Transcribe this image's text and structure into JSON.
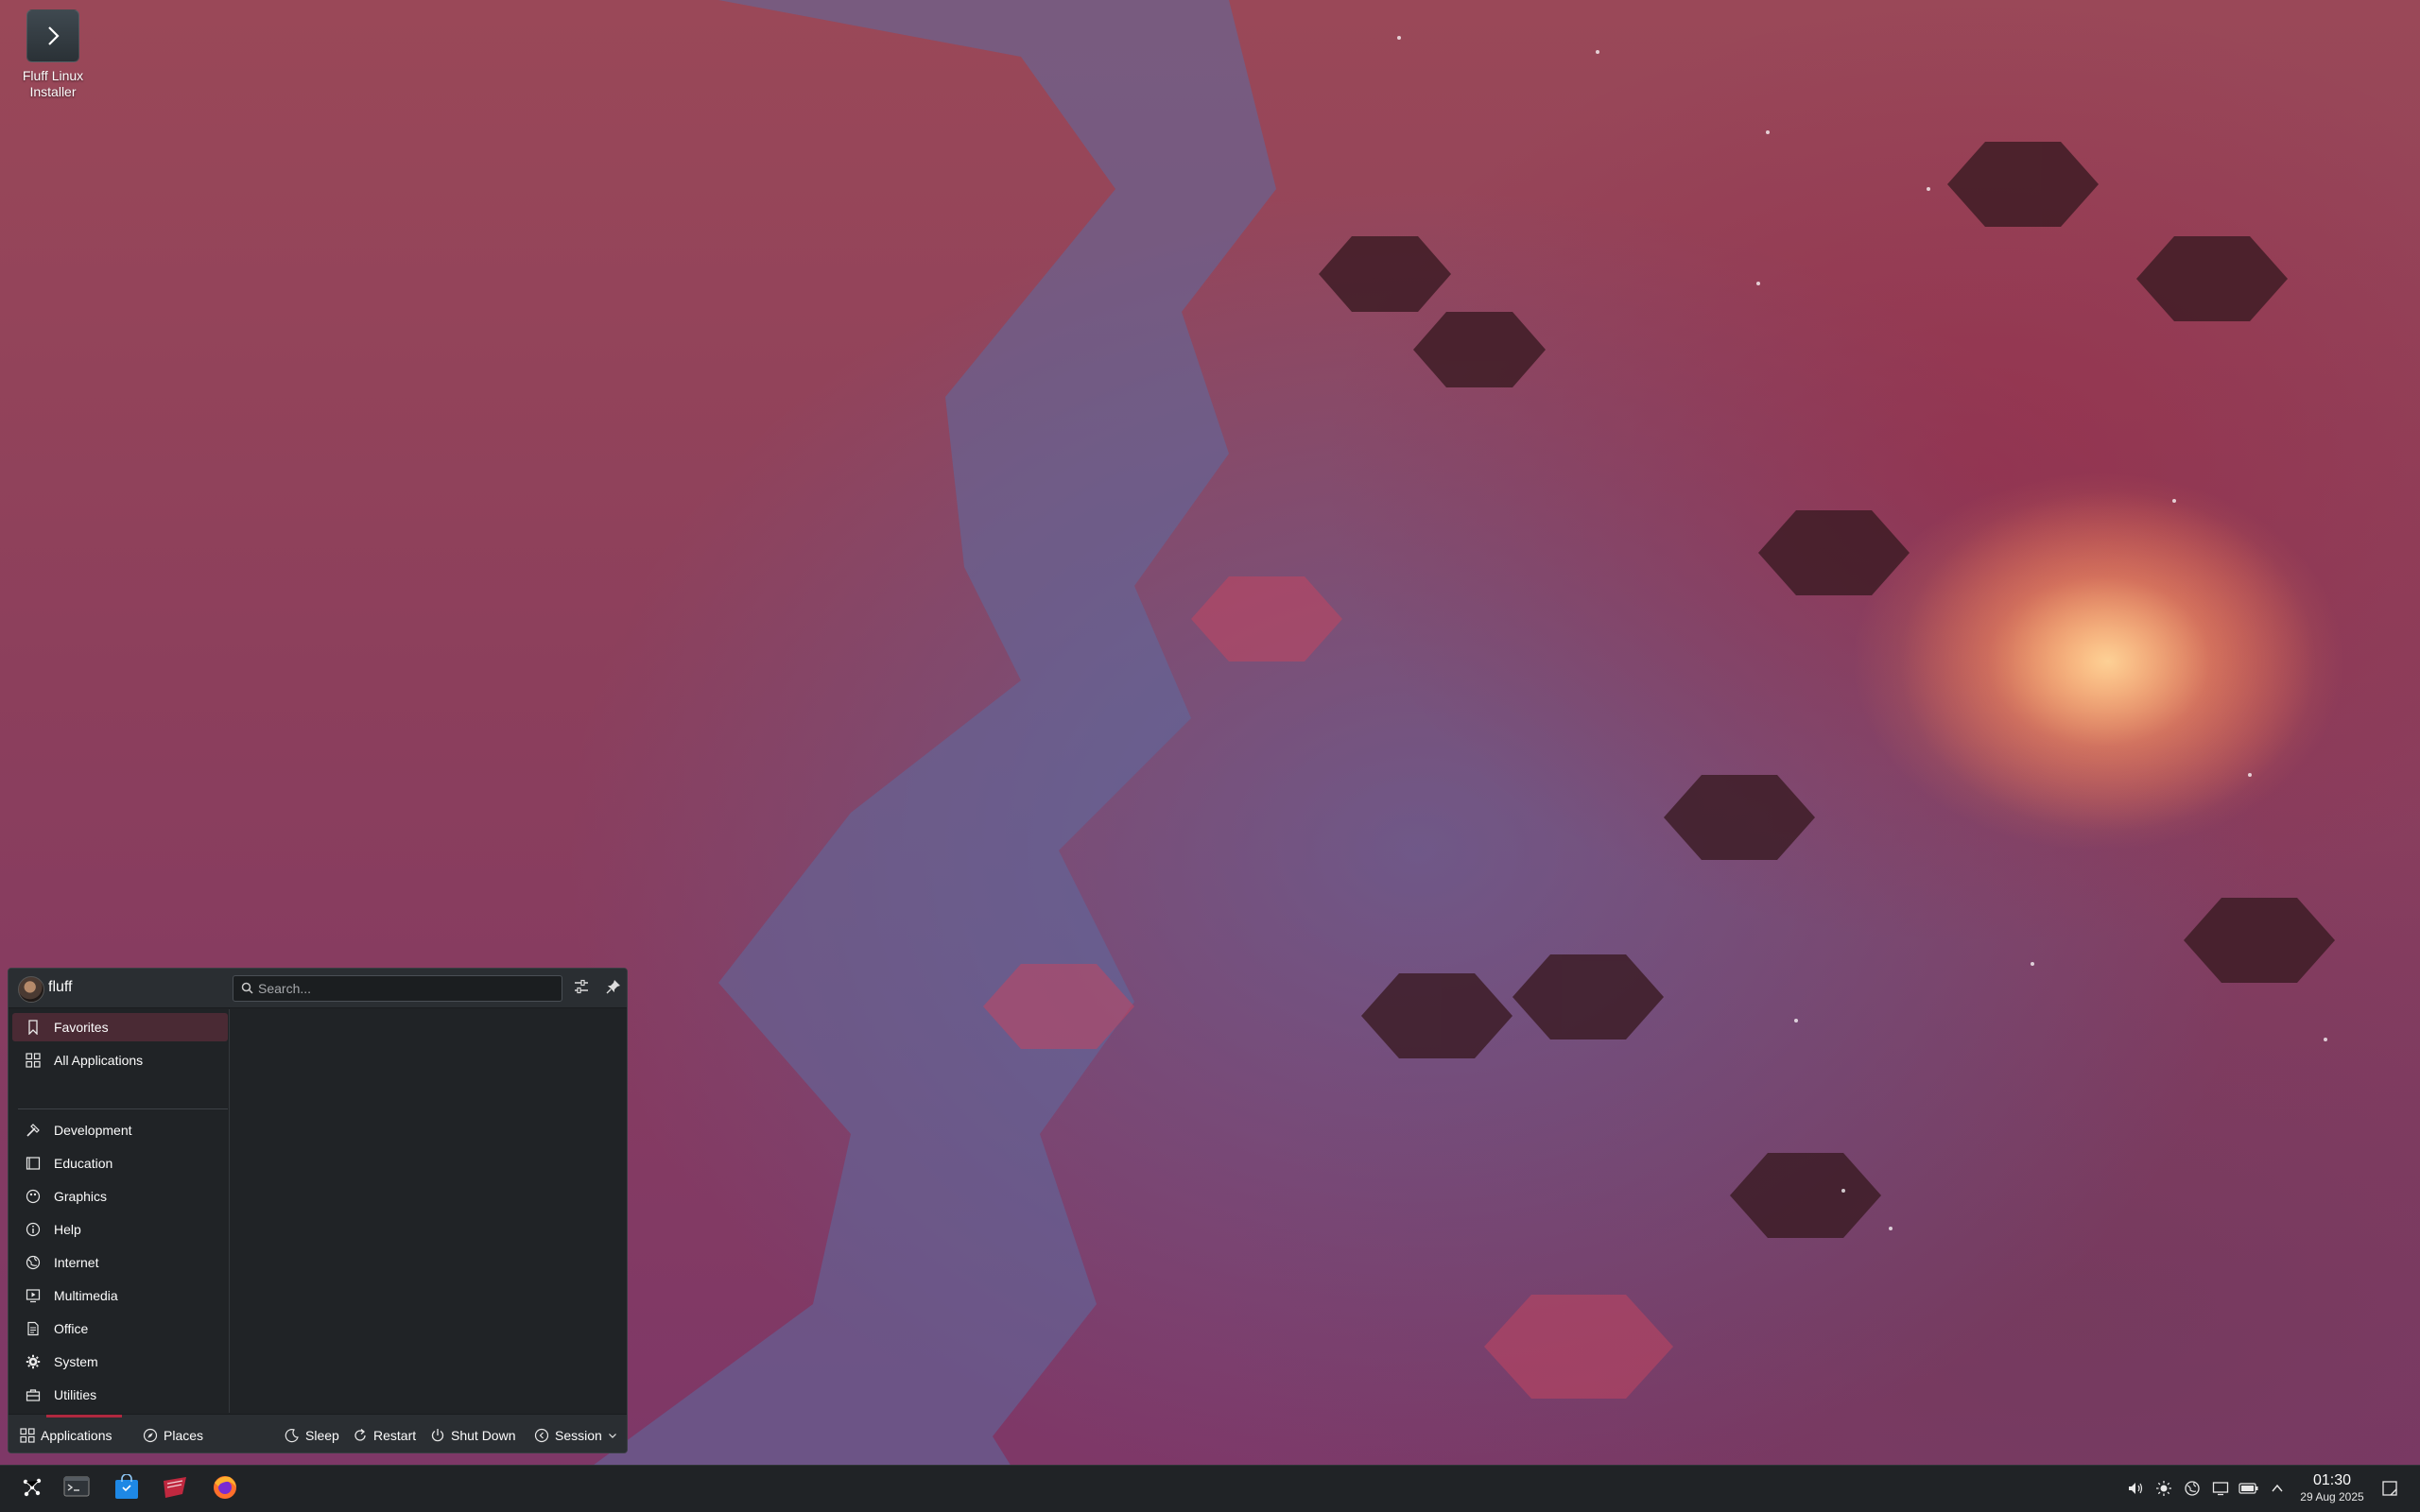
{
  "desktop": {
    "icon": {
      "label": "Fluff Linux Installer",
      "icon": "chevron-right-icon"
    }
  },
  "launcher": {
    "user": {
      "name": "fluff"
    },
    "search": {
      "placeholder": "Search..."
    },
    "header_buttons": [
      {
        "icon": "sliders-icon"
      },
      {
        "icon": "pin-icon"
      }
    ],
    "categories": [
      {
        "label": "Favorites",
        "icon": "bookmark-icon",
        "active": true
      },
      {
        "label": "All Applications",
        "icon": "grid-icon"
      },
      {
        "label": "Development",
        "icon": "hammer-icon"
      },
      {
        "label": "Education",
        "icon": "book-icon"
      },
      {
        "label": "Graphics",
        "icon": "palette-icon"
      },
      {
        "label": "Help",
        "icon": "info-icon"
      },
      {
        "label": "Internet",
        "icon": "globe-icon"
      },
      {
        "label": "Multimedia",
        "icon": "monitor-play-icon"
      },
      {
        "label": "Office",
        "icon": "document-icon"
      },
      {
        "label": "System",
        "icon": "gear-icon"
      },
      {
        "label": "Utilities",
        "icon": "toolbox-icon"
      }
    ],
    "footer": {
      "tabs": [
        {
          "label": "Applications",
          "icon": "grid-icon",
          "active": true
        },
        {
          "label": "Places",
          "icon": "compass-icon"
        }
      ],
      "power": [
        {
          "label": "Sleep",
          "icon": "sleep-icon"
        },
        {
          "label": "Restart",
          "icon": "restart-icon"
        },
        {
          "label": "Shut Down",
          "icon": "power-icon"
        },
        {
          "label": "Session",
          "icon": "session-icon"
        }
      ]
    }
  },
  "taskbar": {
    "apps": [
      {
        "icon": "app-launcher-icon"
      },
      {
        "icon": "terminal-icon"
      },
      {
        "icon": "store-icon"
      },
      {
        "icon": "file-manager-icon"
      },
      {
        "icon": "firefox-icon"
      }
    ],
    "tray": [
      {
        "icon": "volume-icon"
      },
      {
        "icon": "brightness-icon"
      },
      {
        "icon": "network-icon"
      },
      {
        "icon": "display-icon"
      },
      {
        "icon": "battery-icon"
      },
      {
        "icon": "chevron-up-icon"
      }
    ],
    "clock": {
      "time": "01:30",
      "date": "29 Aug 2025"
    },
    "show_desktop_icon": "show-desktop-icon"
  },
  "colors": {
    "accent": "#b0283f",
    "panel": "#202326",
    "panel_header": "#2a2e32"
  }
}
